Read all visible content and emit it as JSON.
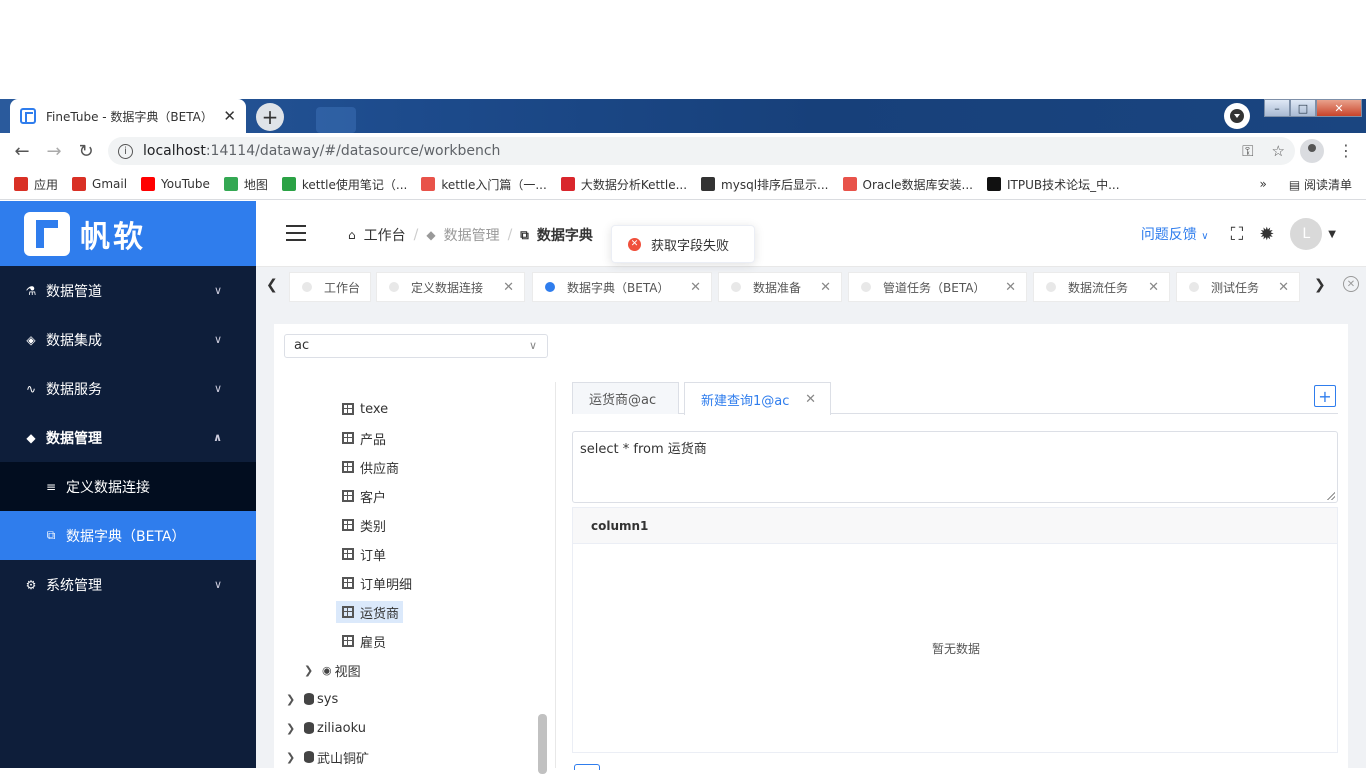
{
  "browser": {
    "tab_title": "FineTube - 数据字典（BETA）",
    "tab_close": "✕",
    "new_tab": "+",
    "url_host": "localhost",
    "url_rest": ":14114/dataway/#/datasource/workbench",
    "win_min": "–",
    "win_max": "□",
    "win_close": "✕",
    "bookmarks": [
      {
        "label": "应用",
        "color": "#d93025"
      },
      {
        "label": "Gmail",
        "color": "#d93025"
      },
      {
        "label": "YouTube",
        "color": "#ff0000"
      },
      {
        "label": "地图",
        "color": "#34a853"
      },
      {
        "label": "kettle使用笔记（...",
        "color": "#2ba245"
      },
      {
        "label": "kettle入门篇（一...",
        "color": "#e8534a"
      },
      {
        "label": "大数据分析Kettle...",
        "color": "#d9262c"
      },
      {
        "label": "mysql排序后显示...",
        "color": "#333333"
      },
      {
        "label": "Oracle数据库安装...",
        "color": "#e8534a"
      },
      {
        "label": "ITPUB技术论坛_中...",
        "color": "#111111"
      }
    ],
    "bookmarks_more": "»",
    "reading_list": "阅读清单"
  },
  "sidebar": {
    "brand": "帆软",
    "menu": [
      {
        "label": "数据管道",
        "icon": "pipeline-icon"
      },
      {
        "label": "数据集成",
        "icon": "layers-icon"
      },
      {
        "label": "数据服务",
        "icon": "pulse-icon"
      },
      {
        "label": "数据管理",
        "icon": "cube-icon"
      }
    ],
    "submenu": [
      {
        "label": "定义数据连接",
        "icon": "database-icon"
      },
      {
        "label": "数据字典（BETA）",
        "icon": "book-icon"
      }
    ],
    "system": {
      "label": "系统管理",
      "icon": "gear-icon"
    }
  },
  "header": {
    "breadcrumb": [
      "工作台",
      "数据管理",
      "数据字典"
    ],
    "toast": "获取字段失败",
    "feedback": "问题反馈",
    "avatar_letter": "L"
  },
  "page_tabs": [
    {
      "label": "工作台",
      "closable": false
    },
    {
      "label": "定义数据连接",
      "closable": true
    },
    {
      "label": "数据字典（BETA）",
      "closable": true,
      "active": true
    },
    {
      "label": "数据准备",
      "closable": true
    },
    {
      "label": "管道任务（BETA）",
      "closable": true
    },
    {
      "label": "数据流任务",
      "closable": true
    },
    {
      "label": "测试任务",
      "closable": true
    }
  ],
  "workbench": {
    "database": "ac",
    "tree_tables": [
      "texe",
      "产品",
      "供应商",
      "客户",
      "类别",
      "订单",
      "订单明细",
      "运货商",
      "雇员"
    ],
    "tree_selected": "运货商",
    "tree_views": "视图",
    "tree_dbs": [
      "sys",
      "ziliaoku",
      "武山铜矿"
    ],
    "query_tabs": [
      "运货商@ac",
      "新建查询1@ac"
    ],
    "sql": "select * from 运货商",
    "result_columns": [
      "column1"
    ],
    "empty_text": "暂无数据"
  }
}
